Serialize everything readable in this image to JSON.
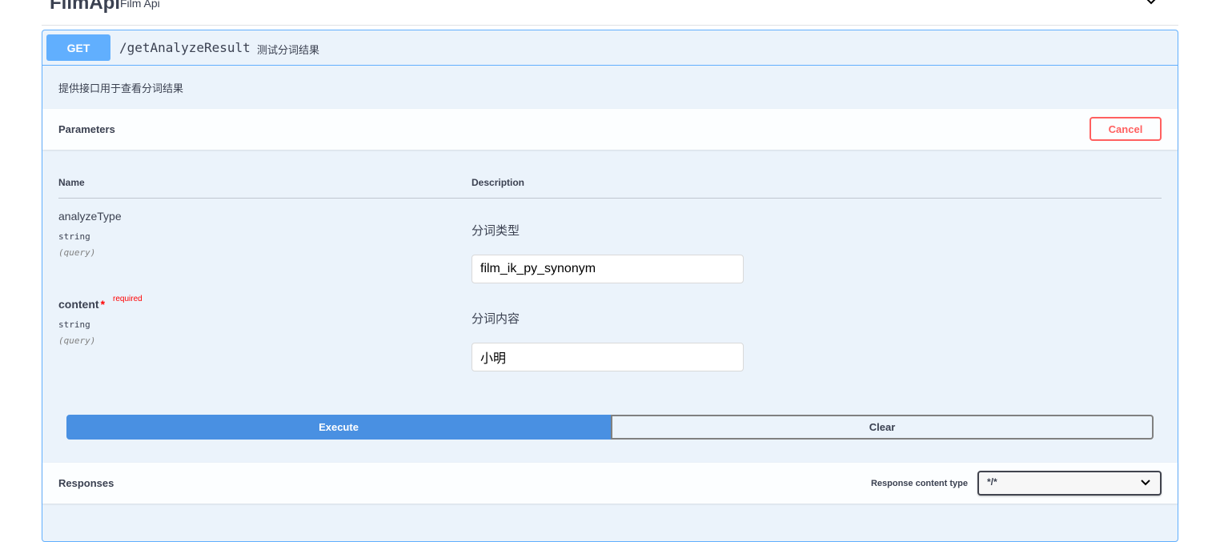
{
  "tag": {
    "title": "FilmApi",
    "description": "Film Api",
    "chevron_icon": "chevron-down-icon"
  },
  "operation": {
    "method": "GET",
    "path": "/getAnalyzeResult",
    "summary": "测试分词结果",
    "description": "提供接口用于查看分词结果",
    "accent_color": "#61affe"
  },
  "parameters_section": {
    "title": "Parameters",
    "cancel_label": "Cancel",
    "columns": {
      "name": "Name",
      "description": "Description"
    },
    "params": [
      {
        "name": "analyzeType",
        "type": "string",
        "in": "(query)",
        "required": false,
        "description": "分词类型",
        "value": "film_ik_py_synonym"
      },
      {
        "name": "content",
        "type": "string",
        "in": "(query)",
        "required": true,
        "required_star": "*",
        "required_label": "required",
        "description": "分词内容",
        "value": "小明"
      }
    ]
  },
  "actions": {
    "execute_label": "Execute",
    "clear_label": "Clear",
    "execute_color": "#4990e2"
  },
  "responses_section": {
    "title": "Responses",
    "content_type_label": "Response content type",
    "content_type_value": "*/*"
  }
}
